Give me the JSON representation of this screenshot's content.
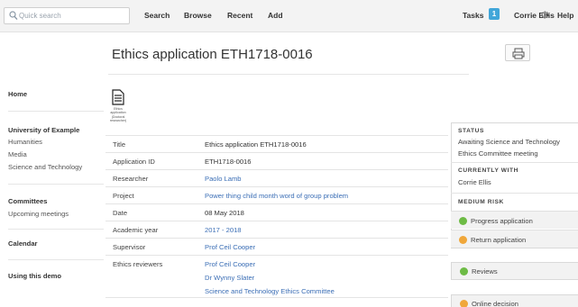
{
  "topbar": {
    "search_placeholder": "Quick search",
    "search_label": "Search",
    "browse_label": "Browse",
    "recent_label": "Recent",
    "add_label": "Add",
    "tasks_label": "Tasks",
    "tasks_count": "1",
    "user_name": "Corrie Ellis",
    "help_label": "Help"
  },
  "sidebar": {
    "home": "Home",
    "org_title": "University of Example",
    "org_items": [
      "Humanities",
      "Media",
      "Science and Technology"
    ],
    "committees_title": "Committees",
    "upcoming": "Upcoming meetings",
    "calendar": "Calendar",
    "using_demo": "Using this demo"
  },
  "page": {
    "title": "Ethics application ETH1718-0016",
    "doc_caption": [
      "Ethics",
      "application",
      "(Doctoral",
      "researcher)"
    ]
  },
  "details": [
    {
      "key": "Title",
      "value": "Ethics application ETH1718-0016",
      "link": false
    },
    {
      "key": "Application ID",
      "value": "ETH1718-0016",
      "link": false
    },
    {
      "key": "Researcher",
      "value": "Paolo Lamb",
      "link": true
    },
    {
      "key": "Project",
      "value": "Power thing child month word of group problem",
      "link": true
    },
    {
      "key": "Date",
      "value": "08 May 2018",
      "link": false
    },
    {
      "key": "Academic year",
      "value": "2017 - 2018",
      "link": true
    },
    {
      "key": "Supervisor",
      "value": "Prof Ceil Cooper",
      "link": true
    }
  ],
  "reviewers": {
    "key": "Ethics reviewers",
    "values": [
      "Prof Ceil Cooper",
      "Dr Wynny Slater",
      "Science and Technology Ethics Committee"
    ]
  },
  "status_panel": {
    "status_head": "STATUS",
    "status_line1": "Awaiting Science and Technology",
    "status_line2": "Ethics Committee meeting",
    "with_head": "CURRENTLY WITH",
    "with_value": "Corrie Ellis",
    "risk_head": "MEDIUM RISK",
    "action1": "Progress application",
    "action2": "Return application",
    "reviews": "Reviews",
    "online_decision": "Online decision"
  },
  "colors": {
    "green": "#6dbb45",
    "orange": "#f0a73a",
    "link": "#3c6fb6",
    "badge": "#41a6d9"
  }
}
